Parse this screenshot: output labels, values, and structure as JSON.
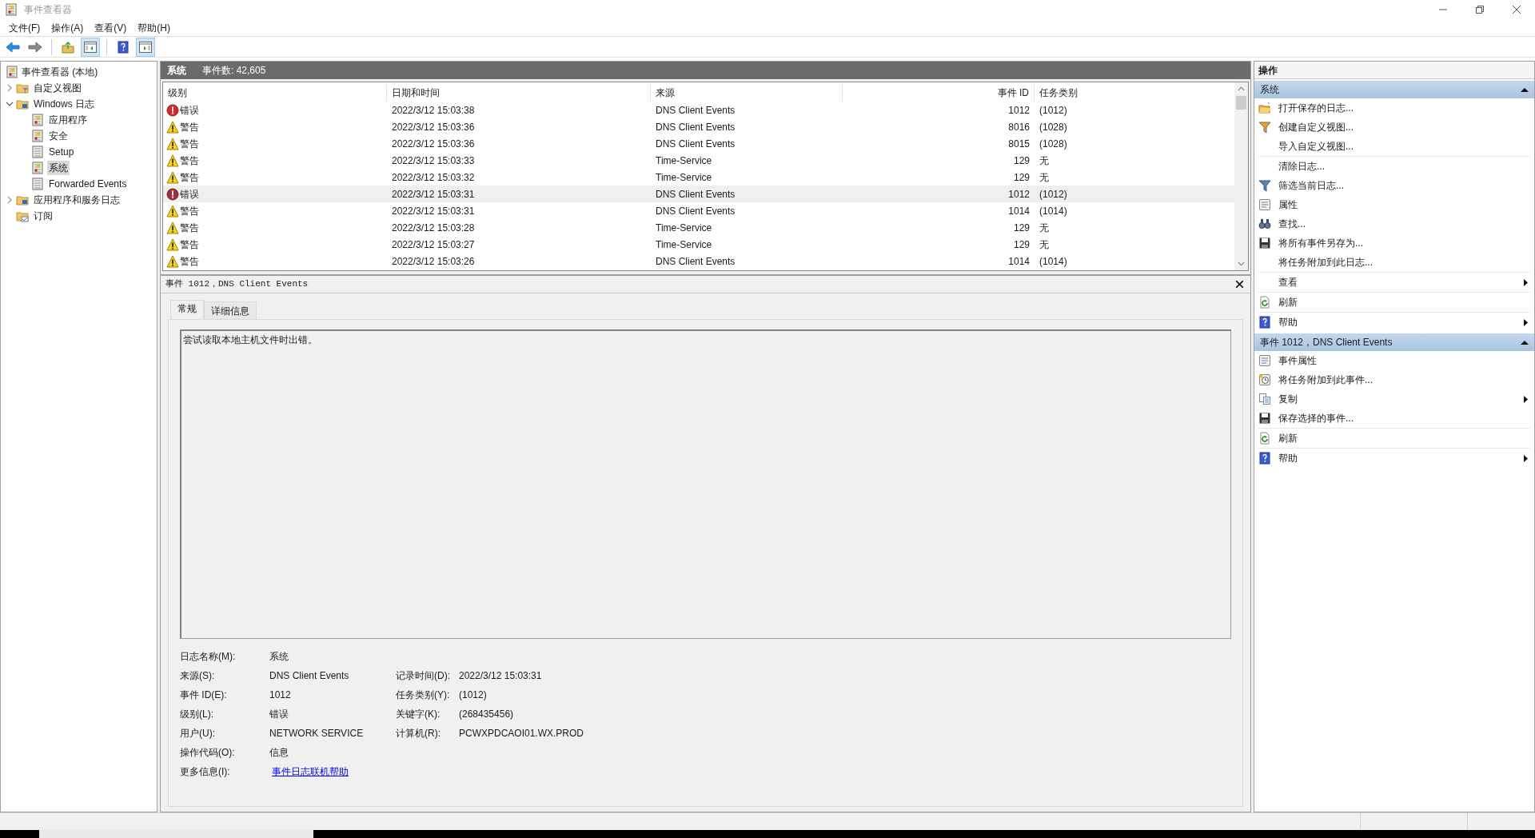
{
  "window": {
    "title": "事件查看器"
  },
  "menu": [
    "文件(F)",
    "操作(A)",
    "查看(V)",
    "帮助(H)"
  ],
  "tree": {
    "label": "事件查看器 (本地)",
    "children": [
      {
        "label": "自定义视图",
        "kind": "filter-folder",
        "expanded": false,
        "selected": false
      },
      {
        "label": "Windows 日志",
        "kind": "folder",
        "expanded": true,
        "selected": false,
        "children": [
          {
            "label": "应用程序",
            "kind": "log",
            "selected": false
          },
          {
            "label": "安全",
            "kind": "log",
            "selected": false
          },
          {
            "label": "Setup",
            "kind": "plain-log",
            "selected": false
          },
          {
            "label": "系统",
            "kind": "log",
            "selected": true
          },
          {
            "label": "Forwarded Events",
            "kind": "plain-log",
            "selected": false
          }
        ]
      },
      {
        "label": "应用程序和服务日志",
        "kind": "folder",
        "expanded": false,
        "selected": false
      },
      {
        "label": "订阅",
        "kind": "subscription-folder",
        "selected": false
      }
    ]
  },
  "log_header": {
    "title": "系统",
    "count": "事件数: 42,605"
  },
  "table": {
    "columns": [
      "级别",
      "日期和时间",
      "来源",
      "事件 ID",
      "任务类别"
    ],
    "rows": [
      {
        "kind": "error",
        "level": "错误",
        "datetime": "2022/3/12 15:03:38",
        "source": "DNS Client Events",
        "event_id": "1012",
        "task": "(1012)",
        "selected": false
      },
      {
        "kind": "warning",
        "level": "警告",
        "datetime": "2022/3/12 15:03:36",
        "source": "DNS Client Events",
        "event_id": "8016",
        "task": "(1028)",
        "selected": false
      },
      {
        "kind": "warning",
        "level": "警告",
        "datetime": "2022/3/12 15:03:36",
        "source": "DNS Client Events",
        "event_id": "8015",
        "task": "(1028)",
        "selected": false
      },
      {
        "kind": "warning",
        "level": "警告",
        "datetime": "2022/3/12 15:03:33",
        "source": "Time-Service",
        "event_id": "129",
        "task": "无",
        "selected": false
      },
      {
        "kind": "warning",
        "level": "警告",
        "datetime": "2022/3/12 15:03:32",
        "source": "Time-Service",
        "event_id": "129",
        "task": "无",
        "selected": false
      },
      {
        "kind": "error",
        "level": "错误",
        "datetime": "2022/3/12 15:03:31",
        "source": "DNS Client Events",
        "event_id": "1012",
        "task": "(1012)",
        "selected": true
      },
      {
        "kind": "warning",
        "level": "警告",
        "datetime": "2022/3/12 15:03:31",
        "source": "DNS Client Events",
        "event_id": "1014",
        "task": "(1014)",
        "selected": false
      },
      {
        "kind": "warning",
        "level": "警告",
        "datetime": "2022/3/12 15:03:28",
        "source": "Time-Service",
        "event_id": "129",
        "task": "无",
        "selected": false
      },
      {
        "kind": "warning",
        "level": "警告",
        "datetime": "2022/3/12 15:03:27",
        "source": "Time-Service",
        "event_id": "129",
        "task": "无",
        "selected": false
      },
      {
        "kind": "warning",
        "level": "警告",
        "datetime": "2022/3/12 15:03:26",
        "source": "DNS Client Events",
        "event_id": "1014",
        "task": "(1014)",
        "selected": false
      }
    ]
  },
  "detail": {
    "title": "事件 1012，DNS Client Events",
    "tabs": [
      {
        "label": "常规",
        "selected": true
      },
      {
        "label": "详细信息",
        "selected": false
      }
    ],
    "message": "尝试读取本地主机文件时出错。",
    "properties": [
      [
        {
          "label": "日志名称(M):",
          "value": "系统"
        }
      ],
      [
        {
          "label": "来源(S):",
          "value": "DNS Client Events"
        },
        {
          "label": "记录时间(D):",
          "value": "2022/3/12 15:03:31"
        }
      ],
      [
        {
          "label": "事件 ID(E):",
          "value": "1012"
        },
        {
          "label": "任务类别(Y):",
          "value": "(1012)"
        }
      ],
      [
        {
          "label": "级别(L):",
          "value": "错误"
        },
        {
          "label": "关键字(K):",
          "value": "(268435456)"
        }
      ],
      [
        {
          "label": "用户(U):",
          "value": "NETWORK SERVICE"
        },
        {
          "label": "计算机(R):",
          "value": "PCWXPDCAOI01.WX.PROD"
        }
      ],
      [
        {
          "label": "操作代码(O):",
          "value": "信息"
        }
      ],
      [
        {
          "label": "更多信息(I):",
          "value": "事件日志联机帮助",
          "kind": "link"
        }
      ]
    ]
  },
  "actions": {
    "title": "操作",
    "sections": [
      {
        "title": "系统",
        "expanded": true,
        "groups": [
          [
            {
              "label": "打开保存的日志...",
              "kind": "open",
              "submenu": false
            },
            {
              "label": "创建自定义视图...",
              "kind": "create",
              "submenu": false
            },
            {
              "label": "导入自定义视图...",
              "kind": "plain",
              "submenu": false
            }
          ],
          [
            {
              "label": "清除日志...",
              "kind": "plain",
              "submenu": false
            },
            {
              "label": "筛选当前日志...",
              "kind": "filter",
              "submenu": false
            },
            {
              "label": "属性",
              "kind": "properties",
              "submenu": false
            },
            {
              "label": "查找...",
              "kind": "find",
              "submenu": false
            },
            {
              "label": "将所有事件另存为...",
              "kind": "save",
              "submenu": false
            },
            {
              "label": "将任务附加到此日志...",
              "kind": "plain",
              "submenu": false
            }
          ],
          [
            {
              "label": "查看",
              "kind": "plain",
              "submenu": true
            }
          ],
          [
            {
              "label": "刷新",
              "kind": "refresh",
              "submenu": false
            }
          ],
          [
            {
              "label": "帮助",
              "kind": "help",
              "submenu": true
            }
          ]
        ]
      },
      {
        "title": "事件 1012，DNS Client Events",
        "expanded": true,
        "groups": [
          [
            {
              "label": "事件属性",
              "kind": "properties",
              "submenu": false
            },
            {
              "label": "将任务附加到此事件...",
              "kind": "task",
              "submenu": false
            },
            {
              "label": "复制",
              "kind": "copy",
              "submenu": true
            },
            {
              "label": "保存选择的事件...",
              "kind": "save",
              "submenu": false
            }
          ],
          [
            {
              "label": "刷新",
              "kind": "refresh",
              "submenu": false
            }
          ],
          [
            {
              "label": "帮助",
              "kind": "help",
              "submenu": true
            }
          ]
        ]
      }
    ]
  }
}
